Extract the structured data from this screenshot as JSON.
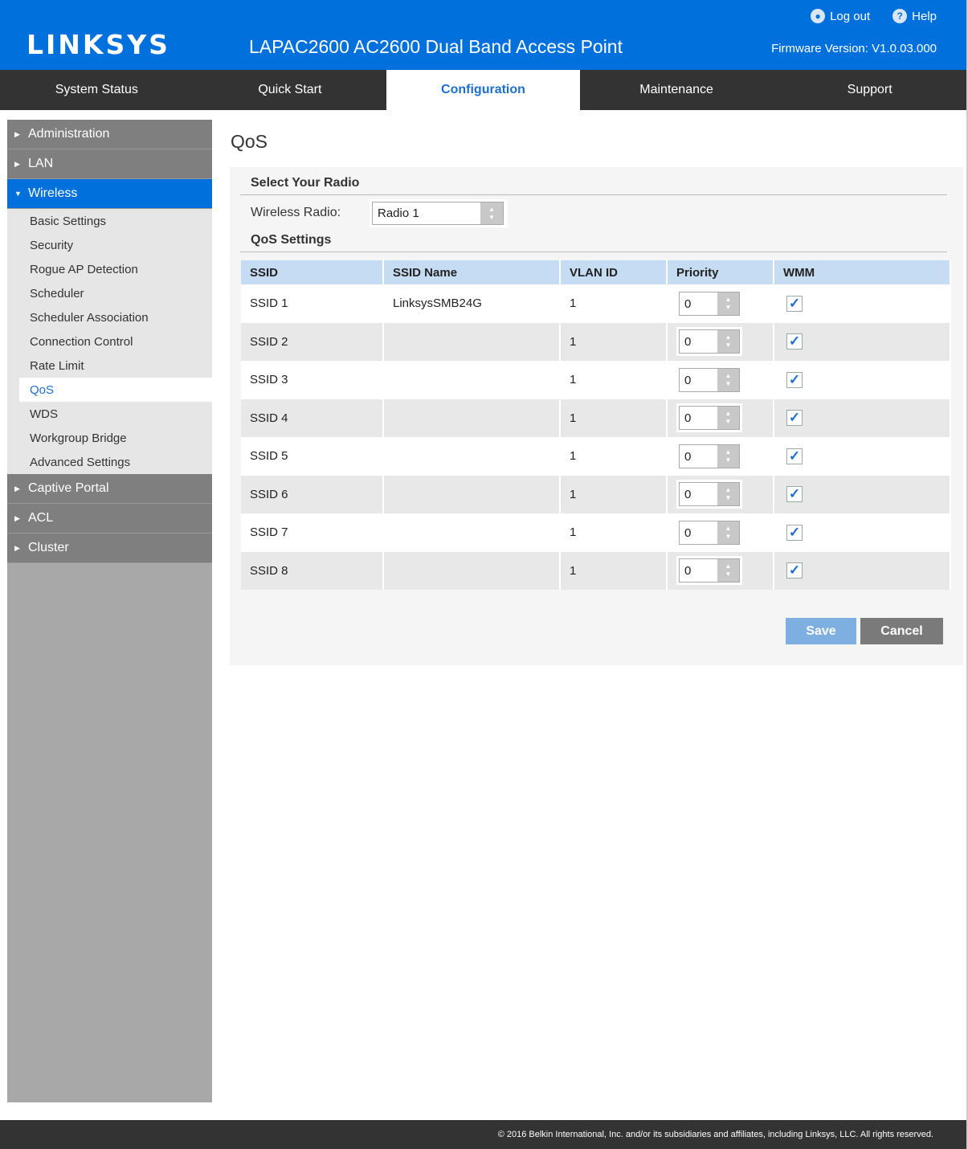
{
  "header": {
    "logo": "LINKSYS",
    "product_title": "LAPAC2600 AC2600 Dual Band Access Point",
    "logout_label": "Log out",
    "help_label": "Help",
    "firmware": "Firmware Version: V1.0.03.000"
  },
  "nav": {
    "tabs": [
      {
        "label": "System Status"
      },
      {
        "label": "Quick Start"
      },
      {
        "label": "Configuration"
      },
      {
        "label": "Maintenance"
      },
      {
        "label": "Support"
      }
    ]
  },
  "sidebar": {
    "groups_top": [
      {
        "label": "Administration"
      },
      {
        "label": "LAN"
      },
      {
        "label": "Wireless"
      }
    ],
    "wireless_items": [
      {
        "label": "Basic Settings"
      },
      {
        "label": "Security"
      },
      {
        "label": "Rogue AP Detection"
      },
      {
        "label": "Scheduler"
      },
      {
        "label": "Scheduler Association"
      },
      {
        "label": "Connection Control"
      },
      {
        "label": "Rate Limit"
      },
      {
        "label": "QoS"
      },
      {
        "label": "WDS"
      },
      {
        "label": "Workgroup Bridge"
      },
      {
        "label": "Advanced Settings"
      }
    ],
    "groups_bottom": [
      {
        "label": "Captive Portal"
      },
      {
        "label": "ACL"
      },
      {
        "label": "Cluster"
      }
    ]
  },
  "main": {
    "title": "QoS",
    "select_radio_heading": "Select Your Radio",
    "wireless_radio_label": "Wireless Radio:",
    "wireless_radio_value": "Radio 1",
    "qos_settings_heading": "QoS Settings",
    "table": {
      "headers": [
        "SSID",
        "SSID Name",
        "VLAN ID",
        "Priority",
        "WMM"
      ],
      "rows": [
        {
          "ssid": "SSID 1",
          "name": "LinksysSMB24G",
          "vlan": "1",
          "priority": "0",
          "wmm": true
        },
        {
          "ssid": "SSID 2",
          "name": "",
          "vlan": "1",
          "priority": "0",
          "wmm": true
        },
        {
          "ssid": "SSID 3",
          "name": "",
          "vlan": "1",
          "priority": "0",
          "wmm": true
        },
        {
          "ssid": "SSID 4",
          "name": "",
          "vlan": "1",
          "priority": "0",
          "wmm": true
        },
        {
          "ssid": "SSID 5",
          "name": "",
          "vlan": "1",
          "priority": "0",
          "wmm": true
        },
        {
          "ssid": "SSID 6",
          "name": "",
          "vlan": "1",
          "priority": "0",
          "wmm": true
        },
        {
          "ssid": "SSID 7",
          "name": "",
          "vlan": "1",
          "priority": "0",
          "wmm": true
        },
        {
          "ssid": "SSID 8",
          "name": "",
          "vlan": "1",
          "priority": "0",
          "wmm": true
        }
      ]
    },
    "save_label": "Save",
    "cancel_label": "Cancel"
  },
  "footer": {
    "copyright": "© 2016 Belkin International, Inc. and/or its subsidiaries and affiliates, including Linksys, LLC. All rights reserved."
  },
  "colors": {
    "brand": "#0071dc",
    "nav_bg": "#333333",
    "table_header": "#c6dcf2"
  }
}
